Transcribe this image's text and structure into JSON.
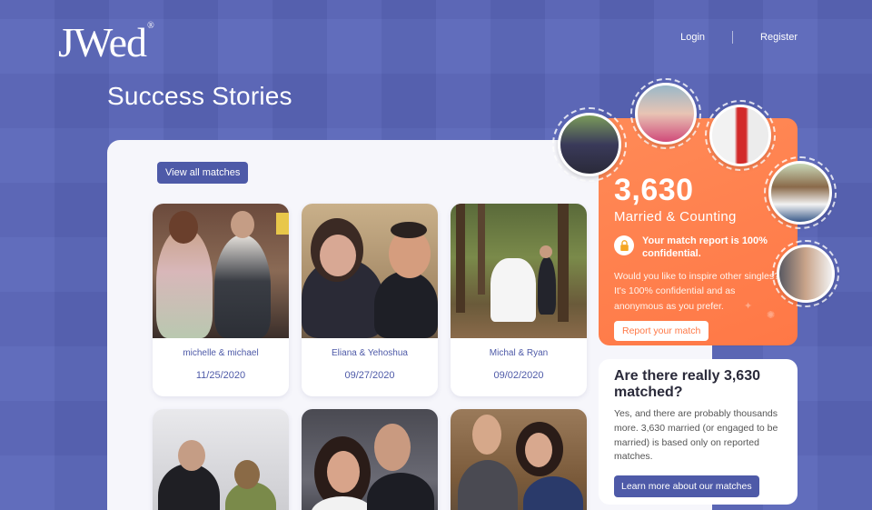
{
  "brand": {
    "logo_text": "JWed",
    "trademark": "®"
  },
  "nav": {
    "login_label": "Login",
    "register_label": "Register"
  },
  "page": {
    "title": "Success Stories"
  },
  "main": {
    "view_all_label": "View all matches",
    "stories": [
      {
        "names": "michelle & michael",
        "date": "11/25/2020",
        "photo": "couple-photo"
      },
      {
        "names": "Eliana & Yehoshua",
        "date": "09/27/2020",
        "photo": "couple-selfie"
      },
      {
        "names": "Michal & Ryan",
        "date": "09/02/2020",
        "photo": "wedding-forest"
      },
      {
        "names": "",
        "date": "",
        "photo": "couple-photo"
      },
      {
        "names": "",
        "date": "",
        "photo": "couple-photo"
      },
      {
        "names": "",
        "date": "",
        "photo": "couple-photo"
      }
    ]
  },
  "stats": {
    "number": "3,630",
    "subtitle": "Married & Counting",
    "confidential_text": "Your match report is 100% confidential.",
    "description": "Would you like to inspire other singles? It's 100% confidential and as anonymous as you prefer.",
    "report_label": "Report your match"
  },
  "info": {
    "title": "Are there really 3,630 matched?",
    "body": "Yes, and there are probably thousands more. 3,630 married (or engaged to be married) is based only on reported matches.",
    "learn_label": "Learn more about our matches"
  },
  "colors": {
    "background": "#5b67ba",
    "accent": "#4e5aa8",
    "orange": "#ff7846",
    "panel": "#f6f6fb"
  }
}
